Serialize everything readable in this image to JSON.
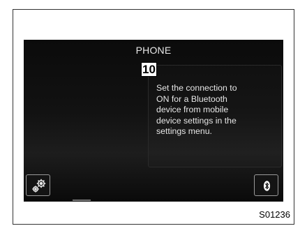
{
  "screen": {
    "title": "PHONE",
    "callout_number": "10",
    "message": "Set the connection to\nON for a Bluetooth\ndevice from mobile\ndevice settings in the\nsettings menu."
  },
  "buttons": {
    "settings_icon": "gears-icon",
    "bluetooth_icon": "bluetooth-icon"
  },
  "figure_id": "S01236",
  "colors": {
    "screen_background": "#111111",
    "screen_text": "#e6e6e6",
    "button_border": "#9a9a9a"
  }
}
